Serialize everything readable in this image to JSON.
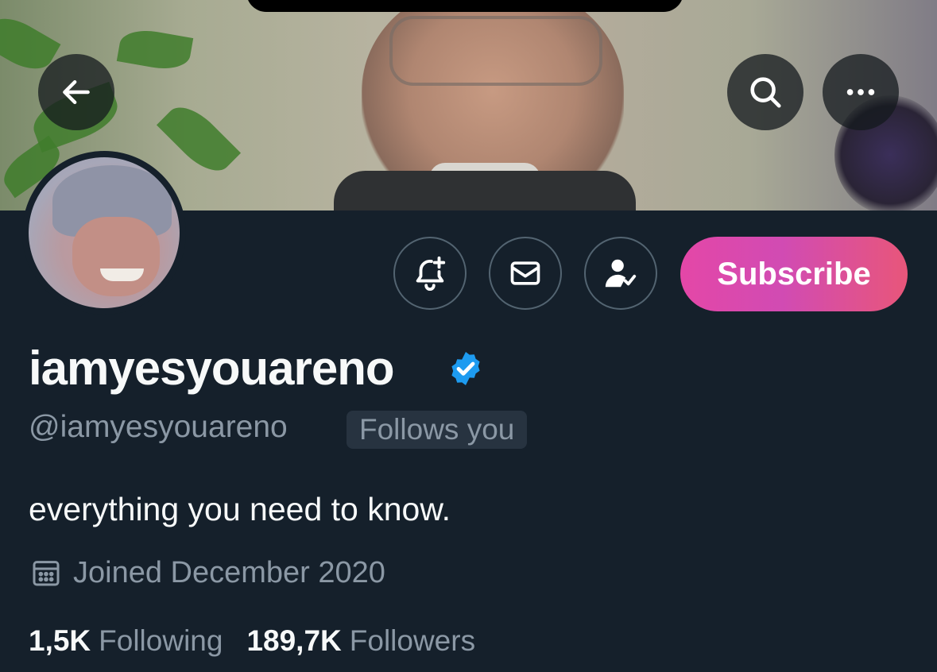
{
  "header": {
    "back_icon": "arrow-left-icon",
    "search_icon": "search-icon",
    "more_icon": "more-horizontal-icon"
  },
  "actions": {
    "notify_icon": "bell-plus-icon",
    "message_icon": "envelope-icon",
    "following_icon": "user-check-icon",
    "subscribe_label": "Subscribe"
  },
  "profile": {
    "display_name": "iamyesyouareno",
    "handle": "@iamyesyouareno",
    "follows_you": "Follows you",
    "bio": "everything you need to know.",
    "joined": "Joined December 2020",
    "following_count": "1,5K",
    "following_label": "Following",
    "followers_count": "189,7K",
    "followers_label": "Followers"
  },
  "colors": {
    "background": "#15202b",
    "verified": "#1d9bf0",
    "secondary_text": "#8b98a5",
    "subscribe_gradient_start": "#e447a7",
    "subscribe_gradient_end": "#e8567a"
  }
}
